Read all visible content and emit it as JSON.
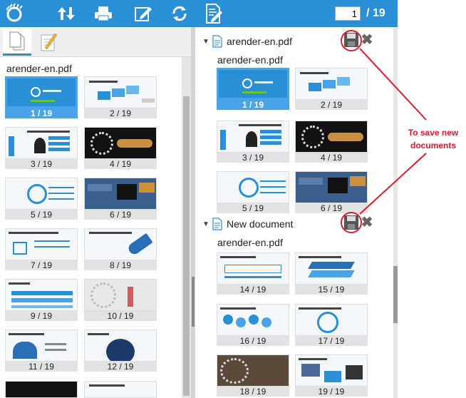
{
  "toolbar": {
    "current_page": "1",
    "total_pages": "/ 19",
    "icons": [
      "logo-icon",
      "sort-icon",
      "print-icon",
      "annotate-icon",
      "rotate-icon",
      "document-edit-icon"
    ]
  },
  "left_panel": {
    "tabs": [
      "thumbnails-tab",
      "notes-tab"
    ],
    "doc_title": "arender-en.pdf",
    "thumbs": [
      "1 / 19",
      "2 / 19",
      "3 / 19",
      "4 / 19",
      "5 / 19",
      "6 / 19",
      "7 / 19",
      "8 / 19",
      "9 / 19",
      "10 / 19",
      "11 / 19",
      "12 / 19"
    ]
  },
  "right_panel": {
    "doc1": {
      "name": "arender-en.pdf",
      "sub": "arender-en.pdf",
      "thumbs": [
        "1 / 19",
        "2 / 19",
        "3 / 19",
        "4 / 19",
        "5 / 19",
        "6 / 19"
      ]
    },
    "doc2": {
      "name": "New document",
      "sub": "arender-en.pdf",
      "thumbs": [
        "14 / 19",
        "15 / 19",
        "16 / 19",
        "17 / 19",
        "18 / 19",
        "19 / 19"
      ]
    }
  },
  "annotation": {
    "line1": "To save new",
    "line2": "documents",
    "color": "#d81e2a"
  },
  "colors": {
    "toolbar": "#2a8fd6",
    "selected": "#4aa3e6"
  }
}
